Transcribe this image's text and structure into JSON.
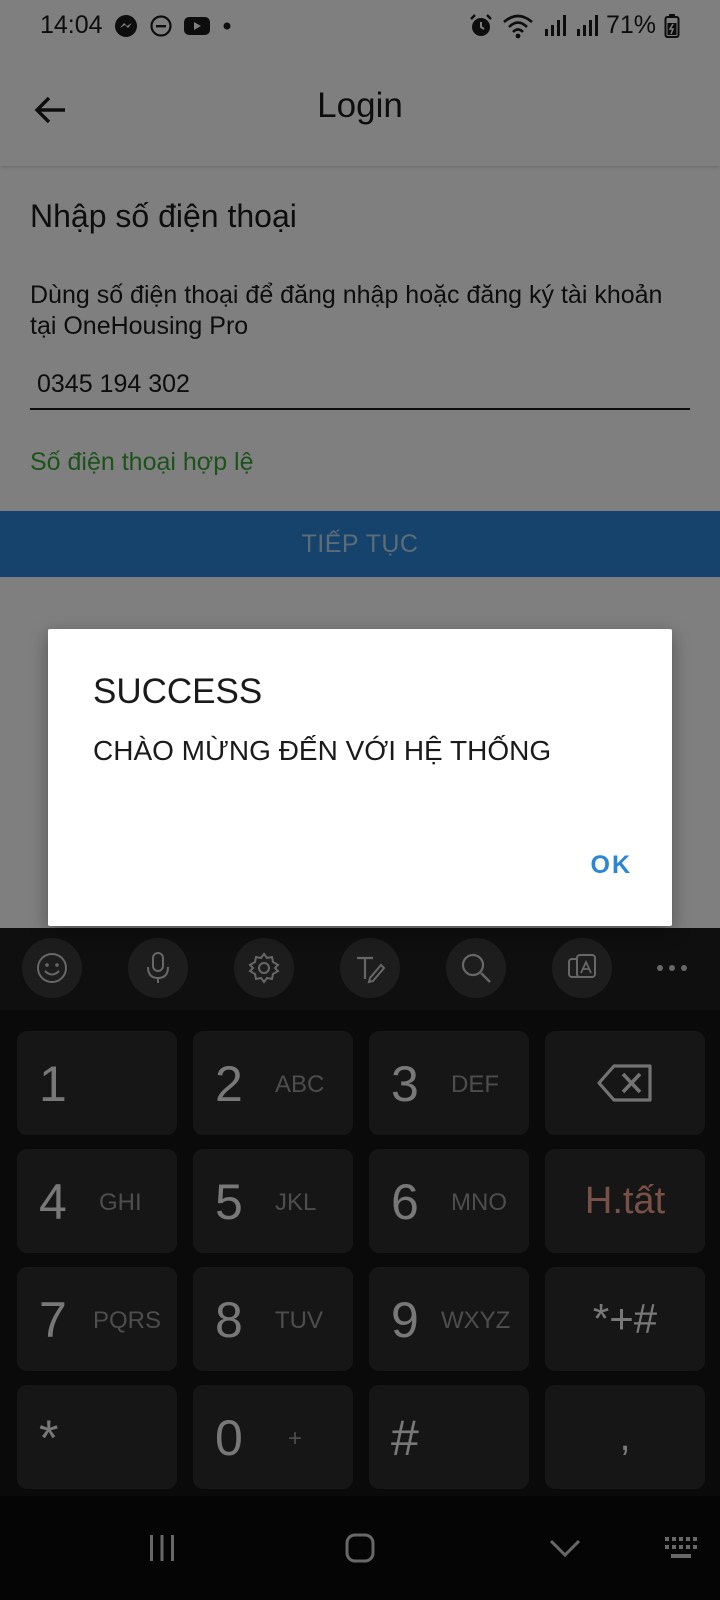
{
  "status_bar": {
    "time": "14:04",
    "left_icons": [
      "messenger-icon",
      "dnd-icon",
      "youtube-icon",
      "dot-icon"
    ],
    "right_icons": [
      "alarm-icon",
      "wifi-icon",
      "signal-icon",
      "signal-icon",
      "battery-icon"
    ],
    "battery": "71%"
  },
  "app_bar": {
    "title": "Login",
    "back_icon": "arrow-back-icon"
  },
  "form": {
    "heading": "Nhập số điện thoại",
    "description": "Dùng số điện thoại để đăng nhập hoặc đăng ký tài khoản tại OneHousing Pro",
    "phone_value": "0345 194 302",
    "valid_message": "Số điện thoại hợp lệ",
    "continue_label": "TIẾP TỤC"
  },
  "dialog": {
    "title": "SUCCESS",
    "message": "CHÀO MỪNG ĐẾN VỚI HỆ THỐNG",
    "ok_label": "OK"
  },
  "keyboard": {
    "toolbar": [
      "emoji-icon",
      "mic-icon",
      "settings-icon",
      "handwriting-icon",
      "search-icon",
      "clipboard-translate-icon",
      "more-icon"
    ],
    "keys": [
      {
        "num": "1",
        "letters": ""
      },
      {
        "num": "2",
        "letters": "ABC"
      },
      {
        "num": "3",
        "letters": "DEF"
      },
      {
        "num": "4",
        "letters": "GHI"
      },
      {
        "num": "5",
        "letters": "JKL"
      },
      {
        "num": "6",
        "letters": "MNO"
      },
      {
        "num": "7",
        "letters": "PQRS"
      },
      {
        "num": "8",
        "letters": "TUV"
      },
      {
        "num": "9",
        "letters": "WXYZ"
      },
      {
        "num": "*",
        "letters": ""
      },
      {
        "num": "0",
        "letters": "+"
      },
      {
        "num": "#",
        "letters": ""
      }
    ],
    "backspace_icon": "backspace-icon",
    "done_label": "H.tất",
    "symbols_label": "*+#",
    "comma_label": ","
  },
  "nav_bar": {
    "items": [
      "recents-icon",
      "home-icon",
      "hide-keyboard-icon",
      "keyboard-icon"
    ]
  },
  "colors": {
    "accent": "#2b86d6",
    "valid": "#3aa53a",
    "done_text": "#f0a08c"
  }
}
